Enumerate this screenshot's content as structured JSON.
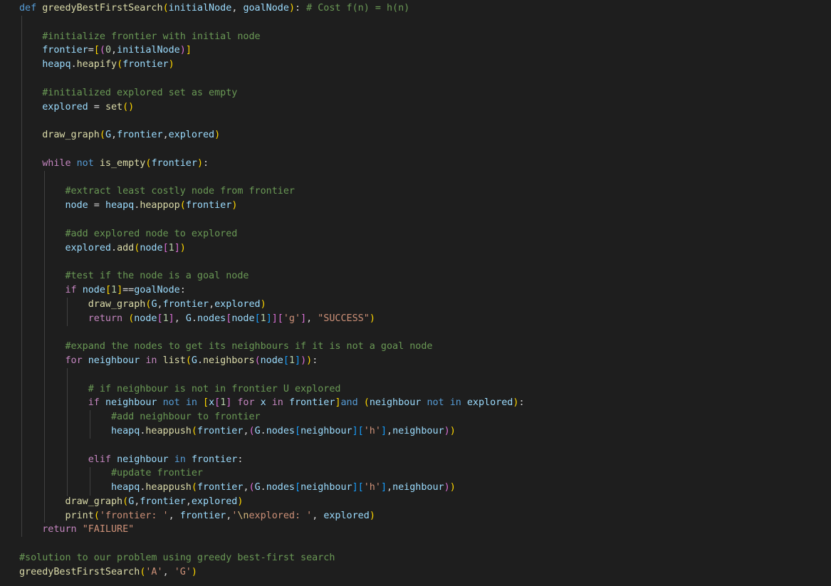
{
  "editor": {
    "language": "python",
    "theme_colors": {
      "background": "#1e1e1e",
      "keyword": "#569cd6",
      "control": "#c586c0",
      "function": "#dcdcaa",
      "variable": "#9cdcfe",
      "string": "#ce9178",
      "number": "#b5cea8",
      "comment": "#6a9955"
    },
    "lines": [
      [
        [
          "kw",
          "def"
        ],
        [
          "op",
          " "
        ],
        [
          "fn",
          "greedyBestFirstSearch"
        ],
        [
          "p1",
          "("
        ],
        [
          "var",
          "initialNode"
        ],
        [
          "op",
          ", "
        ],
        [
          "var",
          "goalNode"
        ],
        [
          "p1",
          ")"
        ],
        [
          "op",
          ": "
        ],
        [
          "cm",
          "# Cost f(n) = h(n)"
        ]
      ],
      [],
      [
        [
          "op",
          "    "
        ],
        [
          "cm",
          "#initialize frontier with initial node"
        ]
      ],
      [
        [
          "op",
          "    "
        ],
        [
          "var",
          "frontier"
        ],
        [
          "op",
          "="
        ],
        [
          "p1",
          "["
        ],
        [
          "p2",
          "("
        ],
        [
          "num",
          "0"
        ],
        [
          "op",
          ","
        ],
        [
          "var",
          "initialNode"
        ],
        [
          "p2",
          ")"
        ],
        [
          "p1",
          "]"
        ]
      ],
      [
        [
          "op",
          "    "
        ],
        [
          "var",
          "heapq"
        ],
        [
          "op",
          "."
        ],
        [
          "fn",
          "heapify"
        ],
        [
          "p1",
          "("
        ],
        [
          "var",
          "frontier"
        ],
        [
          "p1",
          ")"
        ]
      ],
      [],
      [
        [
          "op",
          "    "
        ],
        [
          "cm",
          "#initialized explored set as empty"
        ]
      ],
      [
        [
          "op",
          "    "
        ],
        [
          "var",
          "explored"
        ],
        [
          "op",
          " = "
        ],
        [
          "fn",
          "set"
        ],
        [
          "p1",
          "()"
        ]
      ],
      [],
      [
        [
          "op",
          "    "
        ],
        [
          "fn",
          "draw_graph"
        ],
        [
          "p1",
          "("
        ],
        [
          "var",
          "G"
        ],
        [
          "op",
          ","
        ],
        [
          "var",
          "frontier"
        ],
        [
          "op",
          ","
        ],
        [
          "var",
          "explored"
        ],
        [
          "p1",
          ")"
        ]
      ],
      [],
      [
        [
          "op",
          "    "
        ],
        [
          "ctl",
          "while"
        ],
        [
          "op",
          " "
        ],
        [
          "kw",
          "not"
        ],
        [
          "op",
          " "
        ],
        [
          "fn",
          "is_empty"
        ],
        [
          "p1",
          "("
        ],
        [
          "var",
          "frontier"
        ],
        [
          "p1",
          ")"
        ],
        [
          "op",
          ":"
        ]
      ],
      [],
      [
        [
          "op",
          "        "
        ],
        [
          "cm",
          "#extract least costly node from frontier"
        ]
      ],
      [
        [
          "op",
          "        "
        ],
        [
          "var",
          "node"
        ],
        [
          "op",
          " = "
        ],
        [
          "var",
          "heapq"
        ],
        [
          "op",
          "."
        ],
        [
          "fn",
          "heappop"
        ],
        [
          "p1",
          "("
        ],
        [
          "var",
          "frontier"
        ],
        [
          "p1",
          ")"
        ]
      ],
      [],
      [
        [
          "op",
          "        "
        ],
        [
          "cm",
          "#add explored node to explored"
        ]
      ],
      [
        [
          "op",
          "        "
        ],
        [
          "var",
          "explored"
        ],
        [
          "op",
          "."
        ],
        [
          "fn",
          "add"
        ],
        [
          "p1",
          "("
        ],
        [
          "var",
          "node"
        ],
        [
          "p2",
          "["
        ],
        [
          "num",
          "1"
        ],
        [
          "p2",
          "]"
        ],
        [
          "p1",
          ")"
        ]
      ],
      [],
      [
        [
          "op",
          "        "
        ],
        [
          "cm",
          "#test if the node is a goal node"
        ]
      ],
      [
        [
          "op",
          "        "
        ],
        [
          "ctl",
          "if"
        ],
        [
          "op",
          " "
        ],
        [
          "var",
          "node"
        ],
        [
          "p1",
          "["
        ],
        [
          "num",
          "1"
        ],
        [
          "p1",
          "]"
        ],
        [
          "op",
          "=="
        ],
        [
          "var",
          "goalNode"
        ],
        [
          "op",
          ":"
        ]
      ],
      [
        [
          "op",
          "            "
        ],
        [
          "fn",
          "draw_graph"
        ],
        [
          "p1",
          "("
        ],
        [
          "var",
          "G"
        ],
        [
          "op",
          ","
        ],
        [
          "var",
          "frontier"
        ],
        [
          "op",
          ","
        ],
        [
          "var",
          "explored"
        ],
        [
          "p1",
          ")"
        ]
      ],
      [
        [
          "op",
          "            "
        ],
        [
          "ctl",
          "return"
        ],
        [
          "op",
          " "
        ],
        [
          "p1",
          "("
        ],
        [
          "var",
          "node"
        ],
        [
          "p2",
          "["
        ],
        [
          "num",
          "1"
        ],
        [
          "p2",
          "]"
        ],
        [
          "op",
          ", "
        ],
        [
          "var",
          "G"
        ],
        [
          "op",
          "."
        ],
        [
          "var",
          "nodes"
        ],
        [
          "p2",
          "["
        ],
        [
          "var",
          "node"
        ],
        [
          "p3",
          "["
        ],
        [
          "num",
          "1"
        ],
        [
          "p3",
          "]"
        ],
        [
          "p2",
          "]["
        ],
        [
          "str",
          "'g'"
        ],
        [
          "p2",
          "]"
        ],
        [
          "op",
          ", "
        ],
        [
          "str",
          "\"SUCCESS\""
        ],
        [
          "p1",
          ")"
        ]
      ],
      [],
      [
        [
          "op",
          "        "
        ],
        [
          "cm",
          "#expand the nodes to get its neighbours if it is not a goal node"
        ]
      ],
      [
        [
          "op",
          "        "
        ],
        [
          "ctl",
          "for"
        ],
        [
          "op",
          " "
        ],
        [
          "var",
          "neighbour"
        ],
        [
          "op",
          " "
        ],
        [
          "ctl",
          "in"
        ],
        [
          "op",
          " "
        ],
        [
          "fn",
          "list"
        ],
        [
          "p1",
          "("
        ],
        [
          "var",
          "G"
        ],
        [
          "op",
          "."
        ],
        [
          "fn",
          "neighbors"
        ],
        [
          "p2",
          "("
        ],
        [
          "var",
          "node"
        ],
        [
          "p3",
          "["
        ],
        [
          "num",
          "1"
        ],
        [
          "p3",
          "]"
        ],
        [
          "p2",
          ")"
        ],
        [
          "p1",
          ")"
        ],
        [
          "op",
          ":"
        ]
      ],
      [],
      [
        [
          "op",
          "            "
        ],
        [
          "cm",
          "# if neighbour is not in frontier U explored"
        ]
      ],
      [
        [
          "op",
          "            "
        ],
        [
          "ctl",
          "if"
        ],
        [
          "op",
          " "
        ],
        [
          "var",
          "neighbour"
        ],
        [
          "op",
          " "
        ],
        [
          "kw",
          "not"
        ],
        [
          "op",
          " "
        ],
        [
          "kw",
          "in"
        ],
        [
          "op",
          " "
        ],
        [
          "p1",
          "["
        ],
        [
          "var",
          "x"
        ],
        [
          "p2",
          "["
        ],
        [
          "num",
          "1"
        ],
        [
          "p2",
          "]"
        ],
        [
          "op",
          " "
        ],
        [
          "ctl",
          "for"
        ],
        [
          "op",
          " "
        ],
        [
          "var",
          "x"
        ],
        [
          "op",
          " "
        ],
        [
          "ctl",
          "in"
        ],
        [
          "op",
          " "
        ],
        [
          "var",
          "frontier"
        ],
        [
          "p1",
          "]"
        ],
        [
          "kw",
          "and"
        ],
        [
          "op",
          " "
        ],
        [
          "p1",
          "("
        ],
        [
          "var",
          "neighbour"
        ],
        [
          "op",
          " "
        ],
        [
          "kw",
          "not"
        ],
        [
          "op",
          " "
        ],
        [
          "kw",
          "in"
        ],
        [
          "op",
          " "
        ],
        [
          "var",
          "explored"
        ],
        [
          "p1",
          ")"
        ],
        [
          "op",
          ":"
        ]
      ],
      [
        [
          "op",
          "                "
        ],
        [
          "cm",
          "#add neighbour to frontier"
        ]
      ],
      [
        [
          "op",
          "                "
        ],
        [
          "var",
          "heapq"
        ],
        [
          "op",
          "."
        ],
        [
          "fn",
          "heappush"
        ],
        [
          "p1",
          "("
        ],
        [
          "var",
          "frontier"
        ],
        [
          "op",
          ","
        ],
        [
          "p2",
          "("
        ],
        [
          "var",
          "G"
        ],
        [
          "op",
          "."
        ],
        [
          "var",
          "nodes"
        ],
        [
          "p3",
          "["
        ],
        [
          "var",
          "neighbour"
        ],
        [
          "p3",
          "]["
        ],
        [
          "str",
          "'h'"
        ],
        [
          "p3",
          "]"
        ],
        [
          "op",
          ","
        ],
        [
          "var",
          "neighbour"
        ],
        [
          "p2",
          ")"
        ],
        [
          "p1",
          ")"
        ]
      ],
      [],
      [
        [
          "op",
          "            "
        ],
        [
          "ctl",
          "elif"
        ],
        [
          "op",
          " "
        ],
        [
          "var",
          "neighbour"
        ],
        [
          "op",
          " "
        ],
        [
          "kw",
          "in"
        ],
        [
          "op",
          " "
        ],
        [
          "var",
          "frontier"
        ],
        [
          "op",
          ":"
        ]
      ],
      [
        [
          "op",
          "                "
        ],
        [
          "cm",
          "#update frontier"
        ]
      ],
      [
        [
          "op",
          "                "
        ],
        [
          "var",
          "heapq"
        ],
        [
          "op",
          "."
        ],
        [
          "fn",
          "heappush"
        ],
        [
          "p1",
          "("
        ],
        [
          "var",
          "frontier"
        ],
        [
          "op",
          ","
        ],
        [
          "p2",
          "("
        ],
        [
          "var",
          "G"
        ],
        [
          "op",
          "."
        ],
        [
          "var",
          "nodes"
        ],
        [
          "p3",
          "["
        ],
        [
          "var",
          "neighbour"
        ],
        [
          "p3",
          "]["
        ],
        [
          "str",
          "'h'"
        ],
        [
          "p3",
          "]"
        ],
        [
          "op",
          ","
        ],
        [
          "var",
          "neighbour"
        ],
        [
          "p2",
          ")"
        ],
        [
          "p1",
          ")"
        ]
      ],
      [
        [
          "op",
          "        "
        ],
        [
          "fn",
          "draw_graph"
        ],
        [
          "p1",
          "("
        ],
        [
          "var",
          "G"
        ],
        [
          "op",
          ","
        ],
        [
          "var",
          "frontier"
        ],
        [
          "op",
          ","
        ],
        [
          "var",
          "explored"
        ],
        [
          "p1",
          ")"
        ]
      ],
      [
        [
          "op",
          "        "
        ],
        [
          "fn",
          "print"
        ],
        [
          "p1",
          "("
        ],
        [
          "str",
          "'frontier: '"
        ],
        [
          "op",
          ", "
        ],
        [
          "var",
          "frontier"
        ],
        [
          "op",
          ","
        ],
        [
          "str",
          "'"
        ],
        [
          "esc",
          "\\n"
        ],
        [
          "str",
          "explored: '"
        ],
        [
          "op",
          ", "
        ],
        [
          "var",
          "explored"
        ],
        [
          "p1",
          ")"
        ]
      ],
      [
        [
          "op",
          "    "
        ],
        [
          "ctl",
          "return"
        ],
        [
          "op",
          " "
        ],
        [
          "str",
          "\"FAILURE\""
        ]
      ],
      [],
      [
        [
          "cm",
          "#solution to our problem using greedy best-first search"
        ]
      ],
      [
        [
          "fn",
          "greedyBestFirstSearch"
        ],
        [
          "p1",
          "("
        ],
        [
          "str",
          "'A'"
        ],
        [
          "op",
          ", "
        ],
        [
          "str",
          "'G'"
        ],
        [
          "p1",
          ")"
        ]
      ]
    ]
  }
}
